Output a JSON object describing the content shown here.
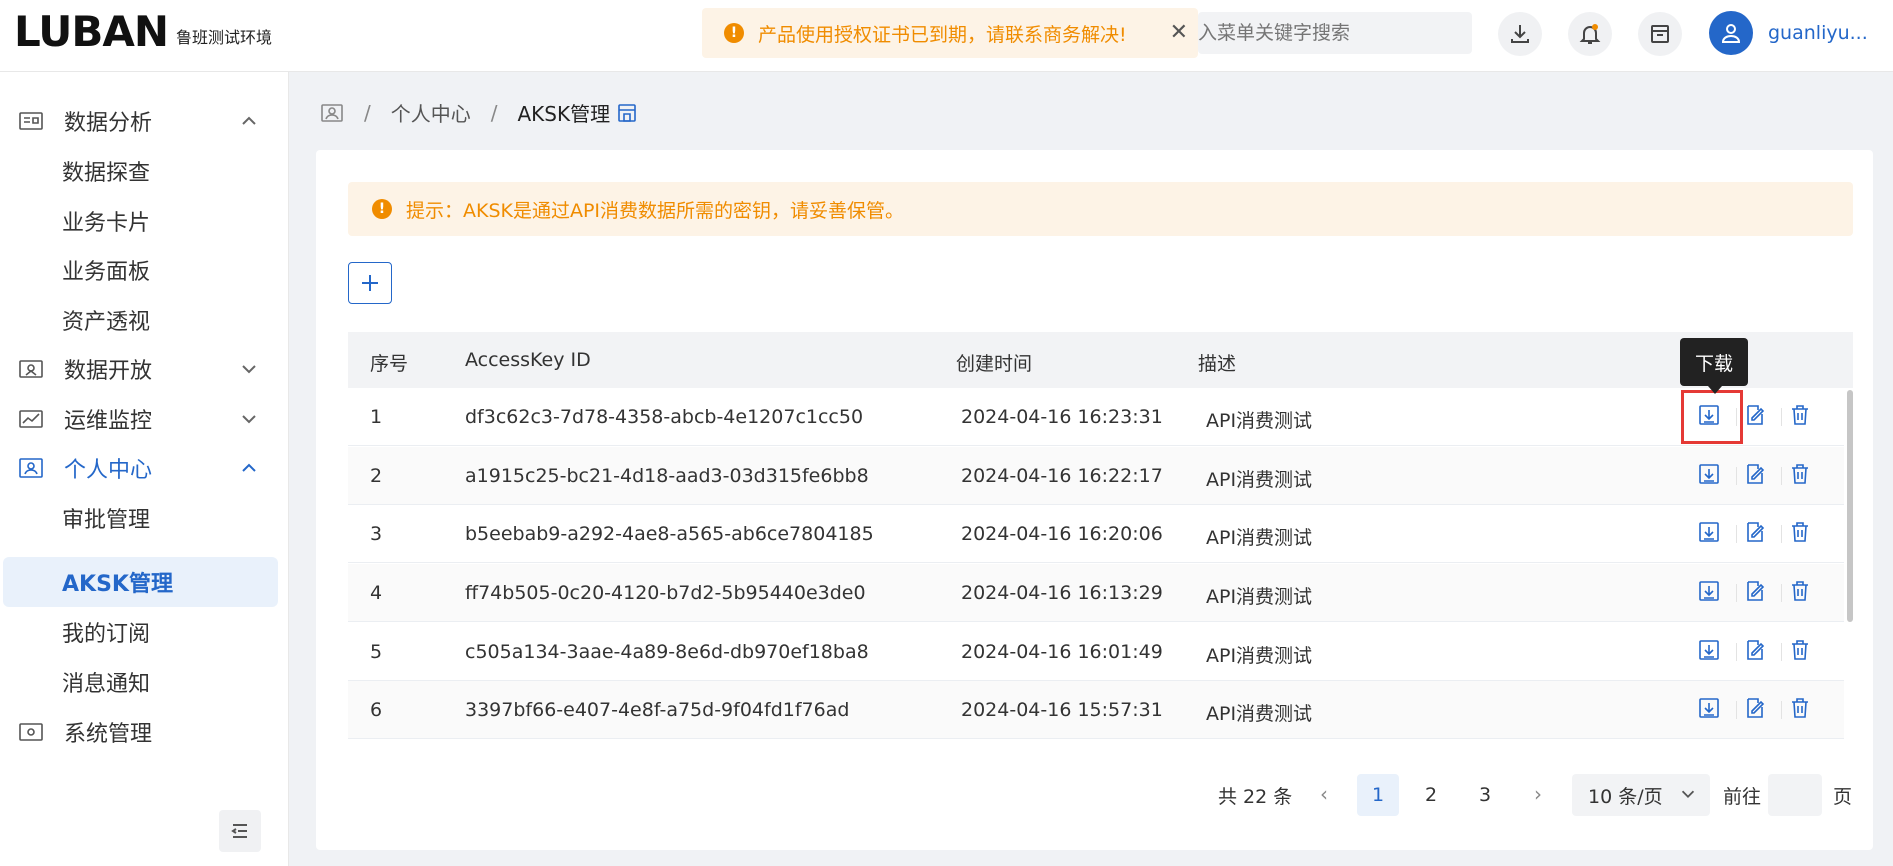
{
  "header": {
    "logo": "LUBAN",
    "logo_sub": "鲁班测试环境",
    "notice": "产品使用授权证书已到期，请联系商务解决!",
    "search_placeholder": "入菜单关键字搜索",
    "username": "guanliyu...",
    "icons": [
      "download-icon",
      "bell-icon",
      "archive-icon",
      "user-icon"
    ]
  },
  "sidebar": {
    "groups": [
      {
        "label": "数据分析",
        "expanded": true,
        "children": [
          "数据探查",
          "业务卡片",
          "业务面板",
          "资产透视"
        ]
      },
      {
        "label": "数据开放",
        "expanded": false
      },
      {
        "label": "运维监控",
        "expanded": false
      },
      {
        "label": "个人中心",
        "expanded": true,
        "children": [
          "审批管理",
          "AKSK管理",
          "我的订阅",
          "消息通知"
        ]
      },
      {
        "label": "系统管理",
        "expanded": false
      }
    ],
    "active_item": "AKSK管理"
  },
  "breadcrumb": {
    "items": [
      "个人中心",
      "AKSK管理"
    ]
  },
  "tip": "提示：AKSK是通过API消费数据所需的密钥，请妥善保管。",
  "table": {
    "columns": [
      "序号",
      "AccessKey ID",
      "创建时间",
      "描述"
    ],
    "rows": [
      {
        "no": "1",
        "id": "df3c62c3-7d78-4358-abcb-4e1207c1cc50",
        "time": "2024-04-16 16:23:31",
        "desc": "API消费测试"
      },
      {
        "no": "2",
        "id": "a1915c25-bc21-4d18-aad3-03d315fe6bb8",
        "time": "2024-04-16 16:22:17",
        "desc": "API消费测试"
      },
      {
        "no": "3",
        "id": "b5eebab9-a292-4ae8-a565-ab6ce7804185",
        "time": "2024-04-16 16:20:06",
        "desc": "API消费测试"
      },
      {
        "no": "4",
        "id": "ff74b505-0c20-4120-b7d2-5b95440e3de0",
        "time": "2024-04-16 16:13:29",
        "desc": "API消费测试"
      },
      {
        "no": "5",
        "id": "c505a134-3aae-4a89-8e6d-db970ef18ba8",
        "time": "2024-04-16 16:01:49",
        "desc": "API消费测试"
      },
      {
        "no": "6",
        "id": "3397bf66-e407-4e8f-a75d-9f04fd1f76ad",
        "time": "2024-04-16 15:57:31",
        "desc": "API消费测试"
      }
    ],
    "tooltip": "下载"
  },
  "pagination": {
    "total": "共 22 条",
    "pages": [
      "1",
      "2",
      "3"
    ],
    "current": "1",
    "page_size": "10 条/页",
    "goto_label": "前往",
    "page_label": "页"
  },
  "colors": {
    "accent": "#2467c9",
    "warning": "#f08c00",
    "warning_bg": "#fdf3e6",
    "highlight": "#e53935"
  }
}
